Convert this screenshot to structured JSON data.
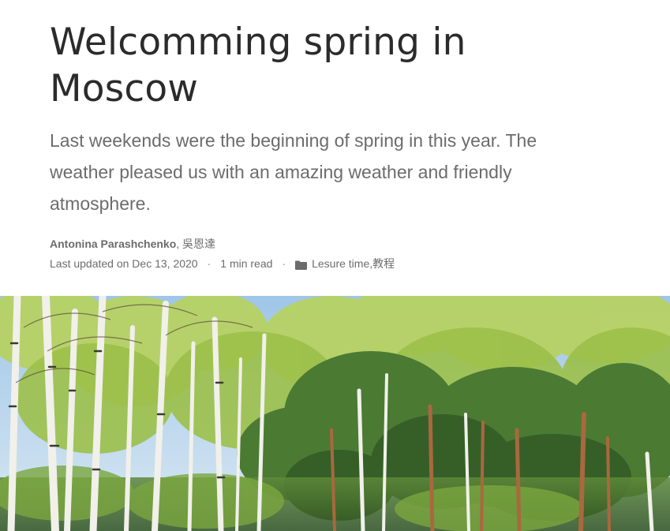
{
  "article": {
    "title": "Welcomming spring in Moscow",
    "summary": "Last weekends were the beginning of spring in this year. The weather pleased us with an amazing weather and friendly atmosphere.",
    "authors": {
      "primary": "Antonina Parashchenko",
      "separator": ", ",
      "secondary": "吳恩達"
    },
    "meta": {
      "updated": "Last updated on Dec 13, 2020",
      "separator": "·",
      "read_time": "1 min read",
      "category_icon": "folder-icon",
      "categories": [
        "Lesure time",
        "教程"
      ],
      "category_separator": ", "
    },
    "featured_image": {
      "subject": "birch and pine forest under a blue spring sky",
      "colors": {
        "sky": "#a9cdea",
        "fresh_green": "#b3cf5a",
        "pine_green": "#3f6a2e",
        "birch_bark": "#f2f2ee"
      }
    }
  }
}
